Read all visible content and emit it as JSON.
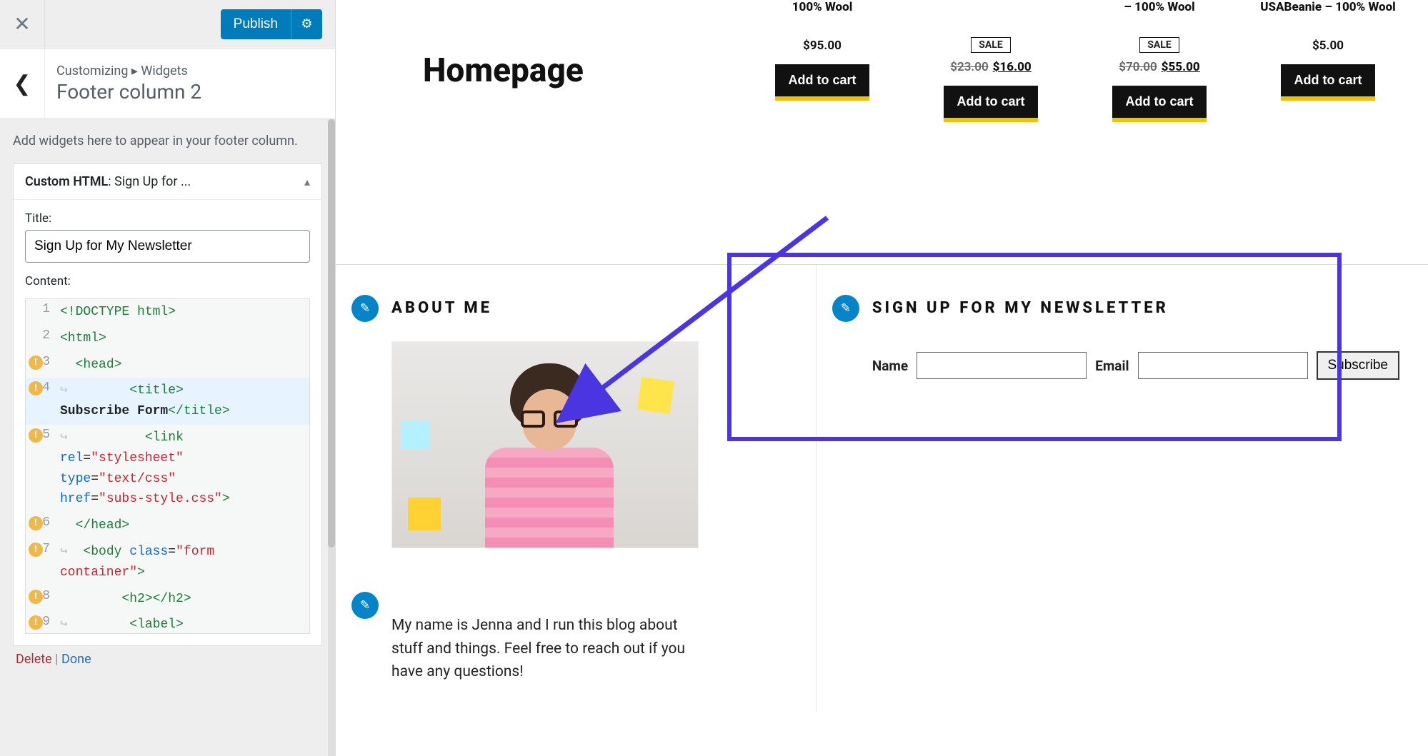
{
  "sidebar": {
    "publish": "Publish",
    "breadcrumb_pre": "Customizing",
    "breadcrumb_sep": "▸",
    "breadcrumb_mid": "Widgets",
    "section_title": "Footer column 2",
    "description": "Add widgets here to appear in your footer column.",
    "widget": {
      "type": "Custom HTML",
      "name_suffix": ": Sign Up for ...",
      "title_label": "Title:",
      "title_value": "Sign Up for My Newsletter",
      "content_label": "Content:",
      "delete": "Delete",
      "sep": " | ",
      "done": "Done"
    },
    "code_lines": [
      {
        "n": "1",
        "warn": false,
        "html": "<span class='t-tag'>&lt;!DOCTYPE html&gt;</span>"
      },
      {
        "n": "2",
        "warn": false,
        "html": "<span class='t-tag'>&lt;html&gt;</span>"
      },
      {
        "n": "3",
        "warn": true,
        "html": "&nbsp;&nbsp;<span class='t-tag'>&lt;head&gt;</span>"
      },
      {
        "n": "4",
        "warn": true,
        "hl": true,
        "html": "<span class='wrap-mark'>↪</span>&nbsp;&nbsp;&nbsp;&nbsp;&nbsp;&nbsp;&nbsp;&nbsp;<span class='t-tag'>&lt;title&gt;</span><br><span class='t-txt'>Subscribe Form</span><span class='t-tag'>&lt;/title&gt;</span>"
      },
      {
        "n": "5",
        "warn": true,
        "html": "<span class='wrap-mark'>↪</span>&nbsp;&nbsp;&nbsp;&nbsp;&nbsp;&nbsp;&nbsp;&nbsp;&nbsp;&nbsp;<span class='t-tag'>&lt;link</span> <br><span class='t-attr'>rel</span>=<span class='t-str'>\"stylesheet\"</span> <br><span class='t-attr'>type</span>=<span class='t-str'>\"text/css\"</span> <br><span class='t-attr'>href</span>=<span class='t-str'>\"subs-style.css\"</span><span class='t-tag'>&gt;</span>"
      },
      {
        "n": "6",
        "warn": true,
        "html": "&nbsp;&nbsp;<span class='t-tag'>&lt;/head&gt;</span>"
      },
      {
        "n": "7",
        "warn": true,
        "html": "<span class='wrap-mark'>↪</span>&nbsp;&nbsp;<span class='t-tag'>&lt;body</span> <span class='t-attr'>class</span>=<span class='t-str'>\"form <br>container\"</span><span class='t-tag'>&gt;</span>"
      },
      {
        "n": "8",
        "warn": true,
        "html": "&nbsp;&nbsp;&nbsp;&nbsp;&nbsp;&nbsp;&nbsp;&nbsp;<span class='t-tag'>&lt;h2&gt;&lt;/h2&gt;</span>"
      },
      {
        "n": "9",
        "warn": true,
        "html": "<span class='wrap-mark'>↪</span>&nbsp;&nbsp;&nbsp;&nbsp;&nbsp;&nbsp;&nbsp;&nbsp;<span class='t-tag'>&lt;label&gt;</span><br><span class='t-tag'>&lt;b&gt;</span><span class='t-txt'>Name</span><span class='t-tag'>&lt;/b&gt;&lt;/label&gt;</span>"
      }
    ]
  },
  "preview": {
    "page_title": "Homepage",
    "products": [
      {
        "name": "100% Wool",
        "sale": false,
        "old": "",
        "new": "$95.00",
        "atc": "Add to cart"
      },
      {
        "name": "",
        "sale": true,
        "old": "$23.00",
        "new": "$16.00",
        "atc": "Add to cart"
      },
      {
        "name": "– 100% Wool",
        "sale": true,
        "old": "$70.00",
        "new": "$55.00",
        "atc": "Add to cart"
      },
      {
        "name": "USABeanie – 100% Wool",
        "sale": false,
        "old": "",
        "new": "$5.00",
        "atc": "Add to cart"
      }
    ],
    "sale_label": "SALE",
    "about": {
      "heading": "ABOUT ME",
      "body": "My name is Jenna and I run this blog about stuff and things. Feel free to reach out if you have any questions!"
    },
    "signup": {
      "heading": "SIGN UP FOR MY NEWSLETTER",
      "name_label": "Name",
      "email_label": "Email",
      "button": "Subscribe"
    }
  }
}
